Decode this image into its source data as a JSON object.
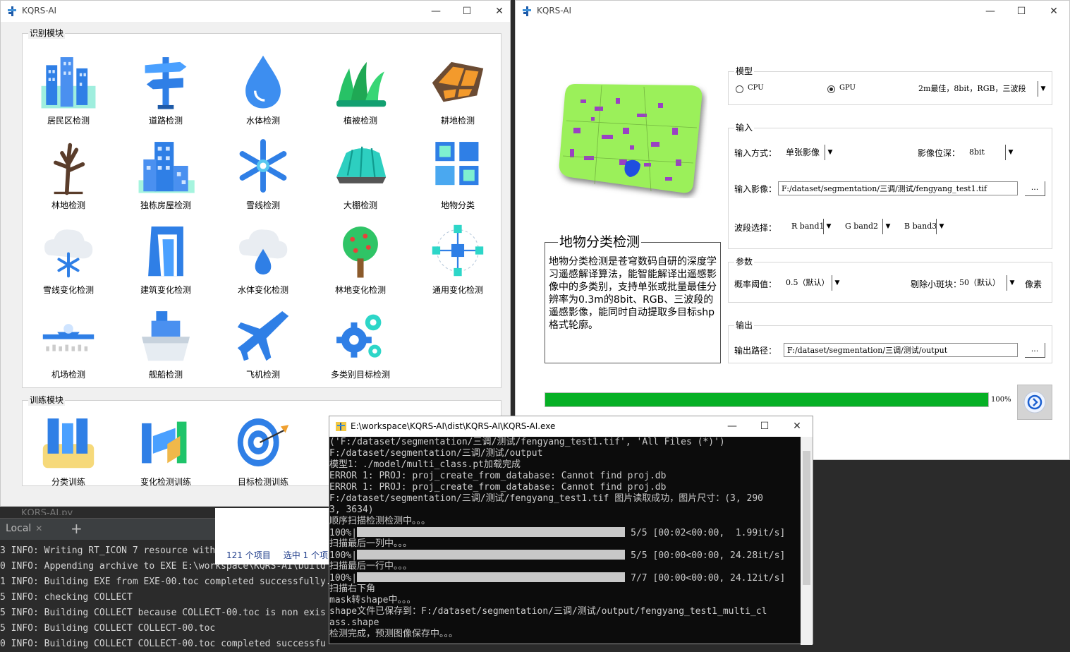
{
  "ide": {
    "tab_label": "Local",
    "ghost_title": "KQRS-AI.py",
    "lines": [
      "3 INFO: Writing RT_ICON 7 resource with",
      "0 INFO: Appending archive to EXE E:\\workspace\\KQRS-AI\\build",
      "1 INFO: Building EXE from EXE-00.toc completed successfully.",
      "5 INFO: checking COLLECT",
      "5 INFO: Building COLLECT because COLLECT-00.toc is non exis",
      "5 INFO: Building COLLECT COLLECT-00.toc",
      "0 INFO: Building COLLECT COLLECT-00.toc completed successfu"
    ]
  },
  "explorer": {
    "items_count": "121 个项目",
    "selected": "选中 1 个项"
  },
  "window1": {
    "title": "KQRS-AI",
    "recognition_group": "识别模块",
    "training_group": "训练模块",
    "tiles": [
      {
        "label": "居民区检测",
        "icon": "residential-icon"
      },
      {
        "label": "道路检测",
        "icon": "road-sign-icon"
      },
      {
        "label": "水体检测",
        "icon": "water-drop-icon"
      },
      {
        "label": "植被检测",
        "icon": "grass-icon"
      },
      {
        "label": "耕地检测",
        "icon": "farmland-icon"
      },
      {
        "label": "林地检测",
        "icon": "tree-icon"
      },
      {
        "label": "独栋房屋检测",
        "icon": "house-icon"
      },
      {
        "label": "雪线检测",
        "icon": "snowflake-icon"
      },
      {
        "label": "大棚检测",
        "icon": "greenhouse-icon"
      },
      {
        "label": "地物分类",
        "icon": "grid-icon"
      },
      {
        "label": "雪线变化检测",
        "icon": "snow-cloud-icon"
      },
      {
        "label": "建筑变化检测",
        "icon": "building-icon"
      },
      {
        "label": "水体变化检测",
        "icon": "rain-cloud-icon"
      },
      {
        "label": "林地变化检测",
        "icon": "fruit-tree-icon"
      },
      {
        "label": "通用变化检测",
        "icon": "network-icon"
      },
      {
        "label": "机场检测",
        "icon": "airport-icon"
      },
      {
        "label": "舰船检测",
        "icon": "ship-icon"
      },
      {
        "label": "飞机检测",
        "icon": "airplane-icon"
      },
      {
        "label": "多类别目标检测",
        "icon": "gears-icon"
      }
    ],
    "train_tiles": [
      {
        "label": "分类训练",
        "icon": "classification-icon"
      },
      {
        "label": "变化检测训练",
        "icon": "change-icon"
      },
      {
        "label": "目标检测训练",
        "icon": "target-icon"
      }
    ]
  },
  "window2": {
    "title": "KQRS-AI",
    "model": {
      "group_label": "模型",
      "cpu_label": "CPU",
      "gpu_label": "GPU",
      "selected": "GPU",
      "model_option": "2m最佳，8bit，RGB，三波段"
    },
    "input": {
      "group_label": "输入",
      "mode_label": "输入方式：",
      "mode_value": "单张影像",
      "depth_label": "影像位深：",
      "depth_value": "8bit",
      "image_label": "输入影像：",
      "image_path": "F:/dataset/segmentation/三调/测试/fengyang_test1.tif",
      "browse": "...",
      "band_label": "波段选择：",
      "band_r": "R band1",
      "band_g": "G  band2",
      "band_b": "B band3"
    },
    "params": {
      "group_label": "参数",
      "threshold_label": "概率阈值：",
      "threshold_value": "0.5（默认）",
      "min_patch_label": "剔除小斑块：",
      "min_patch_value": "50（默认）",
      "unit": "像素"
    },
    "output": {
      "group_label": "输出",
      "path_label": "输出路径：",
      "path_value": "F:/dataset/segmentation/三调/测试/output",
      "browse": "..."
    },
    "description": {
      "title": "地物分类检测",
      "text": "地物分类检测是苍穹数码自研的深度学习遥感解译算法，能智能解译出遥感影像中的多类别，支持单张或批量最佳分辨率为0.3m的8bit、RGB、三波段的遥感影像，能同时自动提取多目标shp格式轮廓。"
    },
    "progress": {
      "value": 100,
      "text": "100%"
    },
    "colors": {
      "progress": "#06b025",
      "map_green": "#9bf05a",
      "map_purple": "#9a23d6"
    }
  },
  "console": {
    "title": "E:\\workspace\\KQRS-AI\\dist\\KQRS-AI\\KQRS-AI.exe",
    "lines": [
      {
        "text": "('F:/dataset/segmentation/三调/测试/fengyang_test1.tif', 'All Files (*)')"
      },
      {
        "text": "F:/dataset/segmentation/三调/测试/output"
      },
      {
        "text": "模型1：./model/multi_class.pt加载完成"
      },
      {
        "text": "ERROR 1: PROJ: proj_create_from_database: Cannot find proj.db"
      },
      {
        "text": "ERROR 1: PROJ: proj_create_from_database: Cannot find proj.db"
      },
      {
        "text": "F:/dataset/segmentation/三调/测试/fengyang_test1.tif 图片读取成功，图片尺寸：(3, 290"
      },
      {
        "text": "3, 3634)"
      },
      {
        "text": "顺序扫描检测检测中。。。"
      },
      {
        "prefix": "100%|",
        "suffix": "5/5 [00:02<00:00,  1.99it/s]",
        "bar": 1.0
      },
      {
        "text": "扫描最后一列中。。。"
      },
      {
        "prefix": "100%|",
        "suffix": "5/5 [00:00<00:00, 24.28it/s]",
        "bar": 1.0
      },
      {
        "text": "扫描最后一行中。。。"
      },
      {
        "prefix": "100%|",
        "suffix": "7/7 [00:00<00:00, 24.12it/s]",
        "bar": 1.0
      },
      {
        "text": "扫描右下角"
      },
      {
        "text": "mask转shape中。。。"
      },
      {
        "text": "shape文件已保存到：F:/dataset/segmentation/三调/测试/output/fengyang_test1_multi_cl"
      },
      {
        "text": "ass.shape"
      },
      {
        "text": "检测完成，预测图像保存中。。。"
      }
    ]
  }
}
